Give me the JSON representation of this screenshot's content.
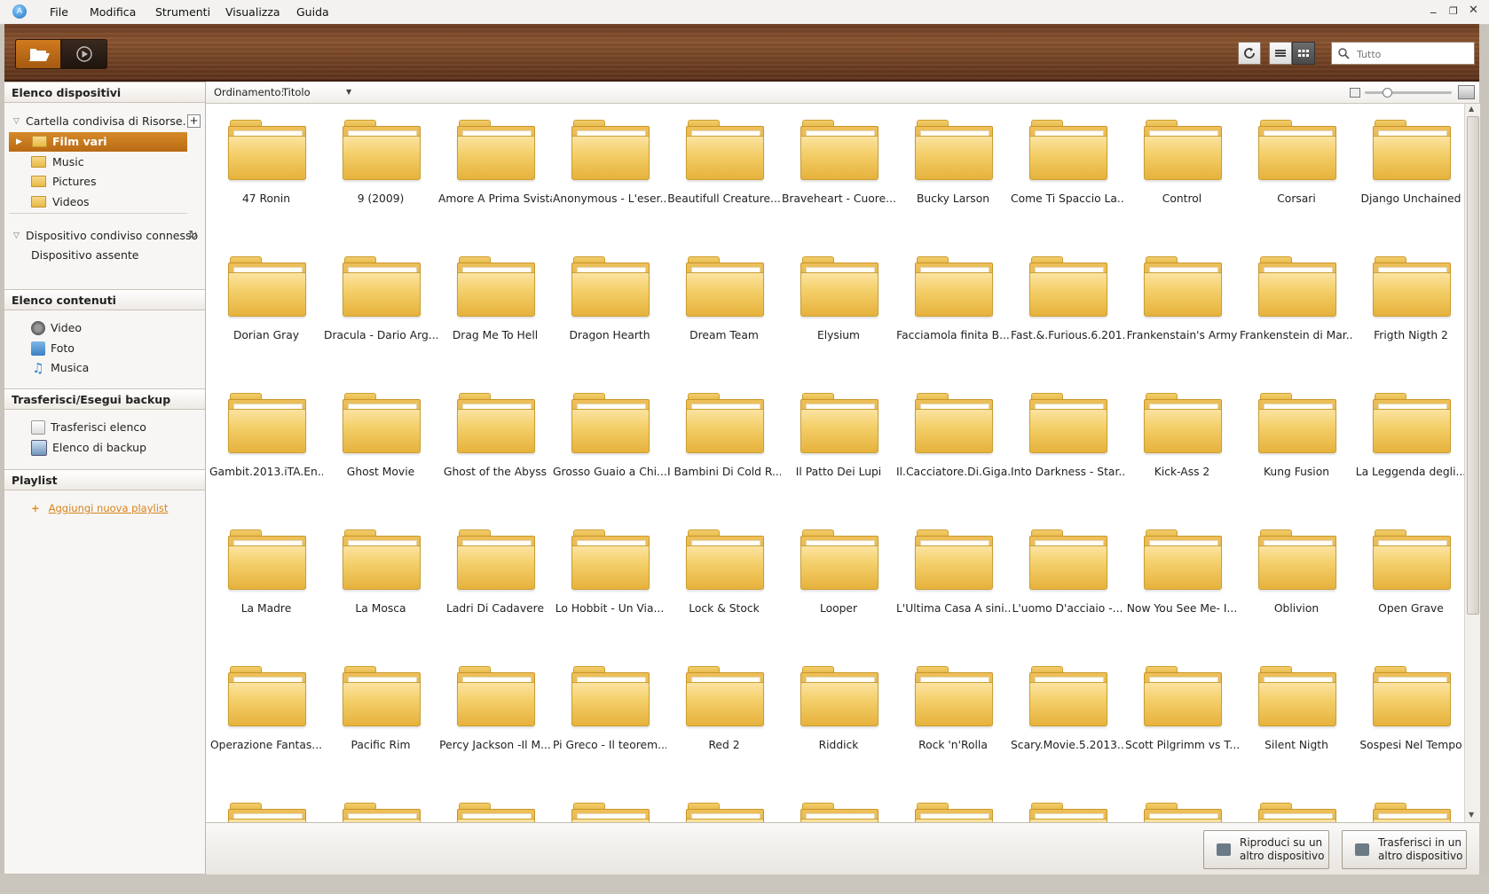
{
  "menubar": {
    "items": [
      "File",
      "Modifica",
      "Strumenti",
      "Visualizza",
      "Guida"
    ],
    "window_controls": [
      "_",
      "❐",
      "✕"
    ]
  },
  "toolbar": {
    "search_placeholder": "Tutto"
  },
  "sidebar": {
    "devices_header": "Elenco dispositivi",
    "shared_folder": "Cartella condivisa di Risorse...",
    "folders": [
      {
        "label": "Film vari",
        "selected": true
      },
      {
        "label": "Music"
      },
      {
        "label": "Pictures"
      },
      {
        "label": "Videos"
      }
    ],
    "connected_device": "Dispositivo condiviso connesso",
    "no_device": "Dispositivo assente",
    "contents_header": "Elenco contenuti",
    "contents": [
      {
        "label": "Video",
        "icon": "film-reel-icon"
      },
      {
        "label": "Foto",
        "icon": "photo-icon"
      },
      {
        "label": "Musica",
        "icon": "music-note-icon"
      }
    ],
    "transfer_header": "Trasferisci/Esegui backup",
    "transfer_items": [
      {
        "label": "Trasferisci elenco",
        "icon": "transfer-icon"
      },
      {
        "label": "Elenco di backup",
        "icon": "backup-icon"
      }
    ],
    "playlist_header": "Playlist",
    "add_playlist": "Aggiungi nuova playlist"
  },
  "sortbar": {
    "label": "Ordinamento:",
    "value": "Titolo"
  },
  "folders": [
    "47 Ronin",
    "9 (2009)",
    "Amore A Prima Svista",
    "Anonymous - L'eser...",
    "Beautifull Creature...",
    "Braveheart - Cuore...",
    "Bucky Larson",
    "Come Ti Spaccio La...",
    "Control",
    "Corsari",
    "Django Unchained",
    "Dorian Gray",
    "Dracula - Dario Arg...",
    "Drag Me To Hell",
    "Dragon Hearth",
    "Dream Team",
    "Elysium",
    "Facciamola finita B...",
    "Fast.&.Furious.6.201...",
    "Frankenstain's Army",
    "Frankenstein di Mar...",
    "Frigth Nigth 2",
    "Gambit.2013.iTA.En...",
    "Ghost Movie",
    "Ghost of the Abyss",
    "Grosso Guaio a Chi...",
    "I Bambini Di Cold R...",
    "Il Patto Dei Lupi",
    "Il.Cacciatore.Di.Giga...",
    "Into Darkness - Star...",
    "Kick-Ass 2",
    "Kung Fusion",
    "La Leggenda degli...",
    "La Madre",
    "La Mosca",
    "Ladri Di Cadavere",
    "Lo Hobbit - Un Via...",
    "Lock & Stock",
    "Looper",
    "L'Ultima Casa A sini...",
    "L'uomo D'acciaio -...",
    "Now You See Me- I...",
    "Oblivion",
    "Open Grave",
    "Operazione Fantas...",
    "Pacific Rim",
    "Percy Jackson -Il M...",
    "Pi Greco - Il teorem...",
    "Red 2",
    "Riddick",
    "Rock 'n'Rolla",
    "Scary.Movie.5.2013....",
    "Scott Pilgrimm vs T...",
    "Silent Nigth",
    "Sospesi Nel Tempo",
    "",
    "",
    "",
    "",
    "",
    "",
    "",
    "",
    "",
    "",
    ""
  ],
  "bottombar": {
    "play_other": "Riproduci su un altro dispositivo",
    "transfer_other": "Trasferisci in un altro dispositivo"
  }
}
